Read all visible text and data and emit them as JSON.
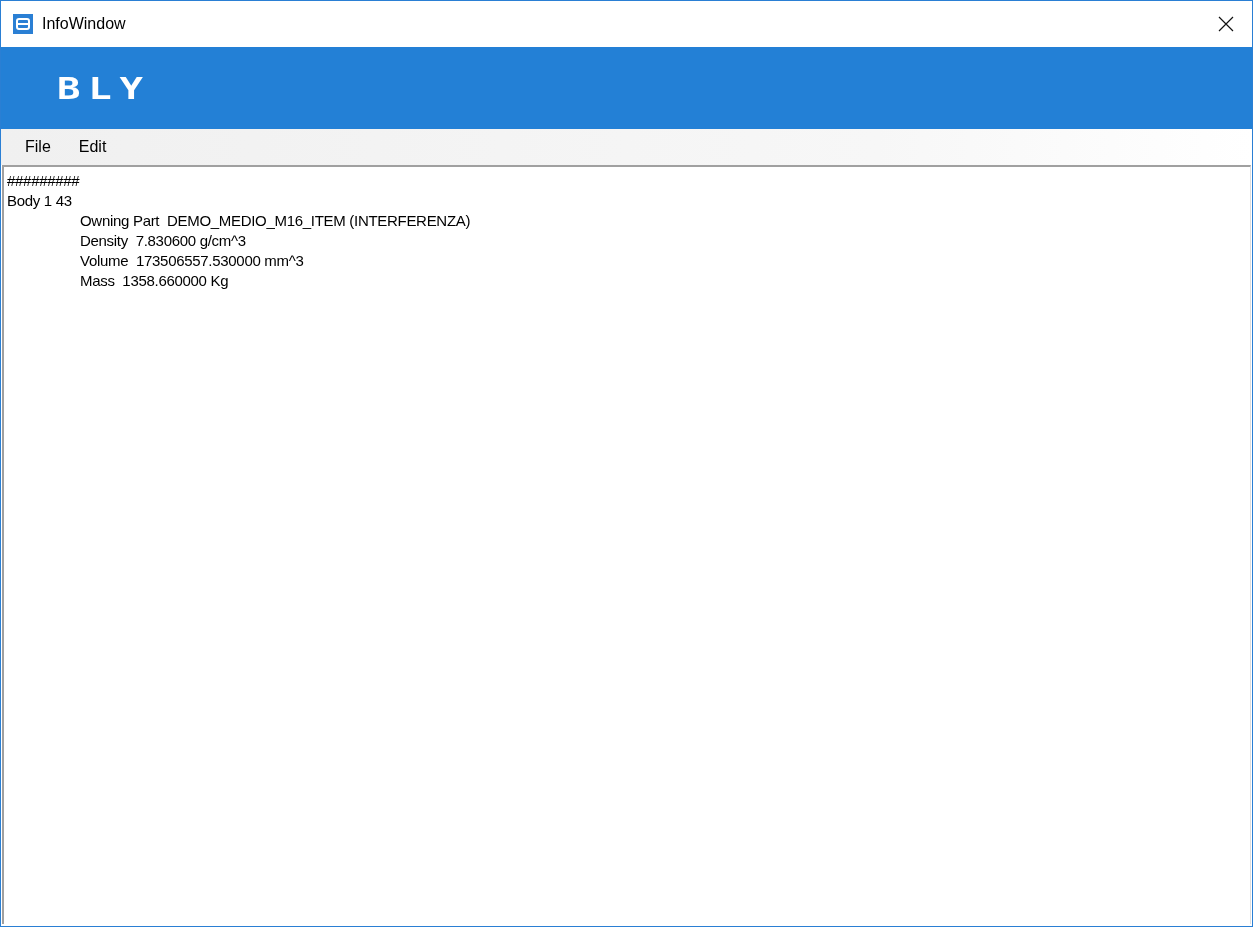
{
  "window": {
    "title": "InfoWindow"
  },
  "banner": {
    "logo": "BLY"
  },
  "menu": [
    {
      "label": "File"
    },
    {
      "label": "Edit"
    }
  ],
  "text_area": {
    "lines": [
      {
        "text": "#########"
      },
      {
        "text": "Body 1 43",
        "children": [
          {
            "text": "Owning Part  DEMO_MEDIO_M16_ITEM (INTERFERENZA)"
          },
          {
            "text": "Density  7.830600 g/cm^3"
          },
          {
            "text": "Volume  173506557.530000 mm^3"
          },
          {
            "text": "Mass  1358.660000 Kg"
          }
        ]
      }
    ]
  }
}
